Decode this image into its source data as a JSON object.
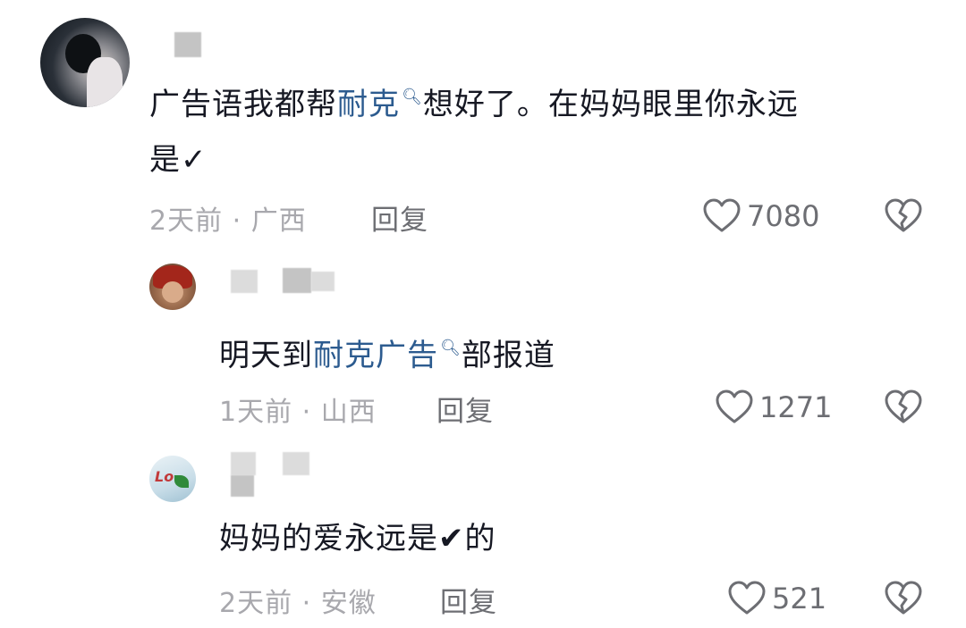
{
  "comments": [
    {
      "text_before": "广告语我都帮",
      "link": "耐克",
      "text_after": "想好了。在妈妈眼里你永远",
      "line2": "是",
      "check": "✓",
      "time_location": "2天前 · 广西",
      "reply_label": "回复",
      "likes": "7080"
    },
    {
      "text_before": "明天到",
      "link": "耐克广告",
      "text_after": "部报道",
      "time_location": "1天前 · 山西",
      "reply_label": "回复",
      "likes": "1271"
    },
    {
      "text_before": "妈妈的爱永远是",
      "check": "✔",
      "text_after": "的",
      "time_location": "2天前 · 安徽",
      "reply_label": "回复",
      "likes": "521"
    }
  ],
  "avatar3_text": "Lo",
  "icons": {
    "search": "search-icon",
    "like": "heart-icon",
    "dislike": "broken-heart-icon"
  },
  "colors": {
    "link": "#2c5b8f",
    "meta": "#a8a8ad",
    "reply": "#6d6e73"
  }
}
